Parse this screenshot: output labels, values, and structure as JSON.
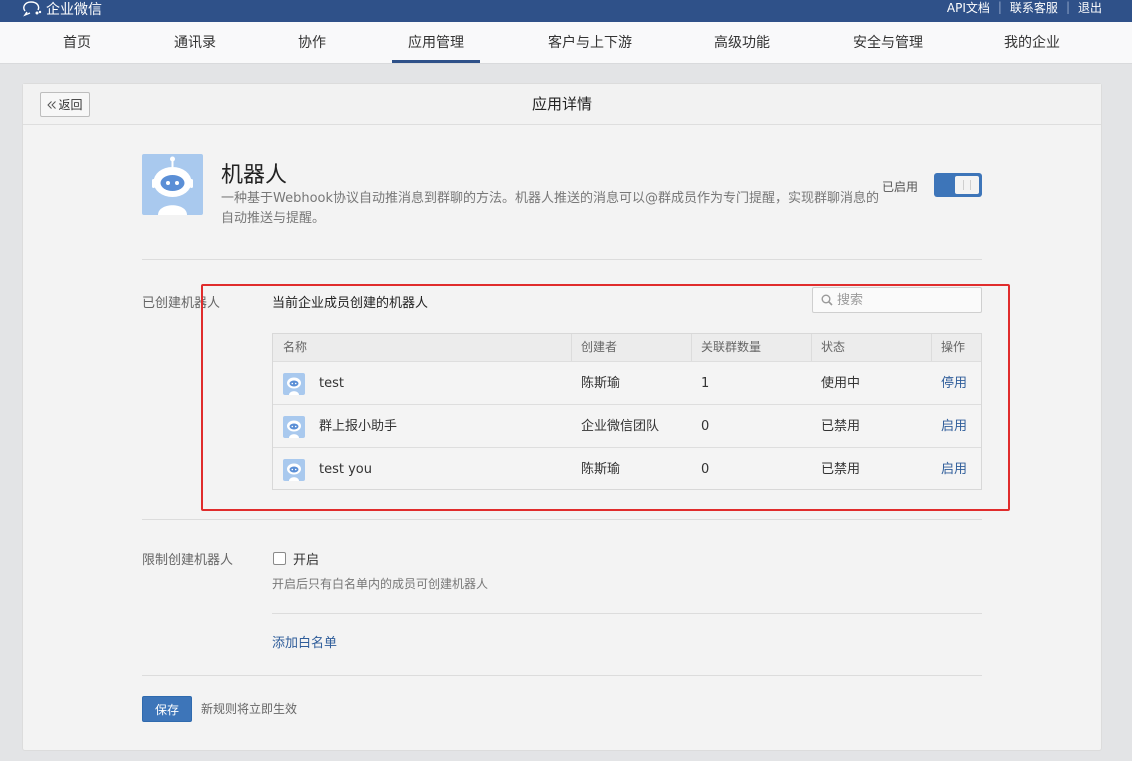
{
  "topbar": {
    "brand": "企业微信",
    "links": [
      "API文档",
      "联系客服",
      "退出"
    ]
  },
  "nav": {
    "items": [
      "首页",
      "通讯录",
      "协作",
      "应用管理",
      "客户与上下游",
      "高级功能",
      "安全与管理",
      "我的企业"
    ],
    "active": "应用管理"
  },
  "header": {
    "back_label": "返回",
    "title": "应用详情"
  },
  "app": {
    "name": "机器人",
    "description": "一种基于Webhook协议自动推消息到群聊的方法。机器人推送的消息可以@群成员作为专门提醒，实现群聊消息的自动推送与提醒。",
    "status_label": "已启用",
    "enabled": true
  },
  "robots": {
    "section_label": "已创建机器人",
    "heading": "当前企业成员创建的机器人",
    "search_placeholder": "搜索",
    "columns": [
      "名称",
      "创建者",
      "关联群数量",
      "状态",
      "操作"
    ],
    "rows": [
      {
        "name": "test",
        "creator": "陈斯瑜",
        "groups": "1",
        "status": "使用中",
        "action": "停用"
      },
      {
        "name": "群上报小助手",
        "creator": "企业微信团队",
        "groups": "0",
        "status": "已禁用",
        "action": "启用"
      },
      {
        "name": "test you",
        "creator": "陈斯瑜",
        "groups": "0",
        "status": "已禁用",
        "action": "启用"
      }
    ]
  },
  "restrict": {
    "label": "限制创建机器人",
    "checkbox_label": "开启",
    "checked": false,
    "hint": "开启后只有白名单内的成员可创建机器人",
    "whitelist_link": "添加白名单"
  },
  "footer": {
    "save_label": "保存",
    "save_hint": "新规则将立即生效"
  },
  "colors": {
    "topbar": "#2f5189",
    "accent": "#3d75b9",
    "link": "#2f5d9a",
    "highlight_box": "#e02c2c"
  }
}
